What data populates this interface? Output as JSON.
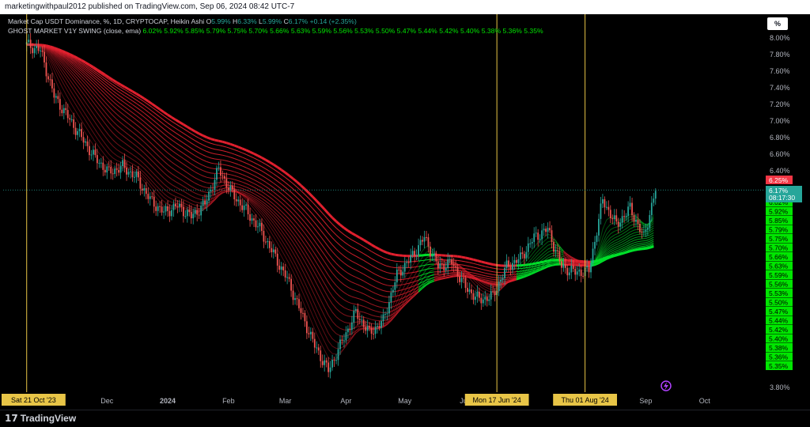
{
  "header": {
    "published_line": "marketingwithpaul2012 published on TradingView.com, Sep 06, 2024 08:42 UTC-7"
  },
  "legend": {
    "symbol": "Market Cap USDT Dominance, %, 1D, CRYPTOCAP, Heikin Ashi",
    "o_label": "O",
    "o_value": "5.99%",
    "h_label": "H",
    "h_value": "6.33%",
    "l_label": "L",
    "l_value": "5.99%",
    "c_label": "C",
    "c_value": "6.17%",
    "change": "+0.14 (+2.35%)",
    "indicator": "GHOST MARKET V1Y SWING (close, ema)",
    "indicator_values": [
      "6.02%",
      "5.92%",
      "5.85%",
      "5.79%",
      "5.75%",
      "5.70%",
      "5.66%",
      "5.63%",
      "5.59%",
      "5.56%",
      "5.53%",
      "5.50%",
      "5.47%",
      "5.44%",
      "5.42%",
      "5.40%",
      "5.38%",
      "5.36%",
      "5.35%"
    ]
  },
  "scale_button": "%",
  "brand": "TradingView",
  "colors": {
    "up": "#26a69a",
    "down": "#ef5350",
    "ribbon_red": "#e0202e",
    "ribbon_green": "#00e02a",
    "vline": "#e8c547",
    "label_green": "#00e600",
    "last_price_bg": "#26a69a",
    "high_label_bg": "#f23645"
  },
  "chart_data": {
    "type": "candlestick",
    "y_axis": {
      "unit": "%",
      "ticks": [
        "8.00%",
        "7.80%",
        "7.60%",
        "7.40%",
        "7.20%",
        "7.00%",
        "6.80%",
        "6.60%",
        "6.40%",
        "3.80%"
      ],
      "min": 3.8,
      "max": 8.0
    },
    "x_axis": {
      "labels": [
        "Dec",
        "2024",
        "Feb",
        "Mar",
        "Apr",
        "May",
        "Jun",
        "Jul",
        "Sep",
        "Oct"
      ],
      "highlighted": [
        "Sat 21 Oct '23",
        "Mon 17 Jun '24",
        "Thu 01 Aug '24"
      ]
    },
    "vertical_markers": [
      "2023-10-21",
      "2024-06-17",
      "2024-08-01"
    ],
    "price_labels": {
      "high": "6.25%",
      "last": "6.17%",
      "countdown": "08:17:30"
    },
    "series": [
      {
        "date": "2023-10-21",
        "value": 7.92
      },
      {
        "date": "2023-10-28",
        "value": 7.85
      },
      {
        "date": "2023-11-04",
        "value": 7.3
      },
      {
        "date": "2023-11-11",
        "value": 7.05
      },
      {
        "date": "2023-11-18",
        "value": 6.8
      },
      {
        "date": "2023-11-25",
        "value": 6.55
      },
      {
        "date": "2023-12-02",
        "value": 6.38
      },
      {
        "date": "2023-12-09",
        "value": 6.45
      },
      {
        "date": "2023-12-16",
        "value": 6.32
      },
      {
        "date": "2023-12-23",
        "value": 6.05
      },
      {
        "date": "2023-12-30",
        "value": 5.9
      },
      {
        "date": "2024-01-06",
        "value": 5.98
      },
      {
        "date": "2024-01-13",
        "value": 5.85
      },
      {
        "date": "2024-01-20",
        "value": 6.0
      },
      {
        "date": "2024-01-27",
        "value": 6.42
      },
      {
        "date": "2024-02-03",
        "value": 6.12
      },
      {
        "date": "2024-02-10",
        "value": 5.92
      },
      {
        "date": "2024-02-17",
        "value": 5.7
      },
      {
        "date": "2024-02-24",
        "value": 5.4
      },
      {
        "date": "2024-03-02",
        "value": 5.1
      },
      {
        "date": "2024-03-09",
        "value": 4.7
      },
      {
        "date": "2024-03-16",
        "value": 4.3
      },
      {
        "date": "2024-03-23",
        "value": 4.0
      },
      {
        "date": "2024-03-30",
        "value": 4.35
      },
      {
        "date": "2024-04-06",
        "value": 4.7
      },
      {
        "date": "2024-04-13",
        "value": 4.45
      },
      {
        "date": "2024-04-20",
        "value": 4.6
      },
      {
        "date": "2024-04-27",
        "value": 5.15
      },
      {
        "date": "2024-05-04",
        "value": 5.35
      },
      {
        "date": "2024-05-11",
        "value": 5.6
      },
      {
        "date": "2024-05-18",
        "value": 5.25
      },
      {
        "date": "2024-05-25",
        "value": 5.3
      },
      {
        "date": "2024-06-01",
        "value": 5.0
      },
      {
        "date": "2024-06-08",
        "value": 4.85
      },
      {
        "date": "2024-06-15",
        "value": 4.9
      },
      {
        "date": "2024-06-22",
        "value": 5.25
      },
      {
        "date": "2024-06-29",
        "value": 5.35
      },
      {
        "date": "2024-07-06",
        "value": 5.6
      },
      {
        "date": "2024-07-13",
        "value": 5.7
      },
      {
        "date": "2024-07-20",
        "value": 5.25
      },
      {
        "date": "2024-07-27",
        "value": 5.18
      },
      {
        "date": "2024-08-03",
        "value": 5.2
      },
      {
        "date": "2024-08-10",
        "value": 6.05
      },
      {
        "date": "2024-08-17",
        "value": 5.75
      },
      {
        "date": "2024-08-24",
        "value": 5.95
      },
      {
        "date": "2024-08-31",
        "value": 5.6
      },
      {
        "date": "2024-09-06",
        "value": 6.17
      }
    ]
  }
}
